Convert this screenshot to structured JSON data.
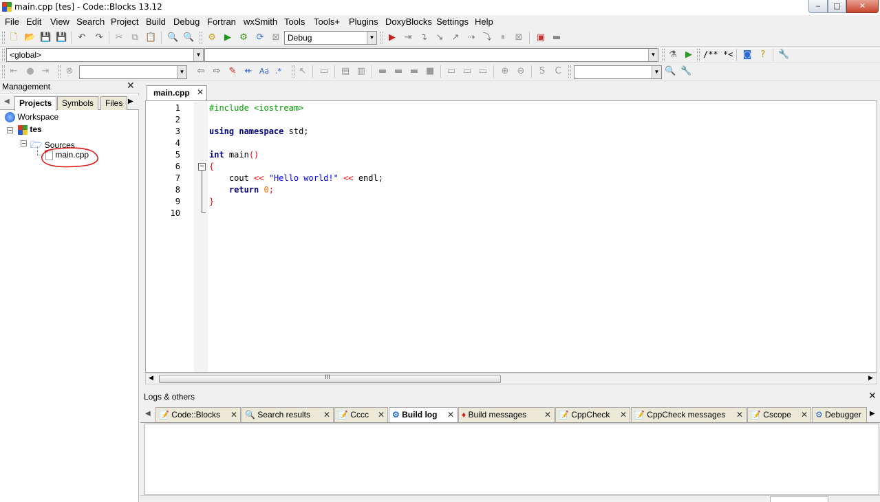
{
  "window": {
    "title": "main.cpp [tes] - Code::Blocks 13.12",
    "min": "‒",
    "max": "□",
    "close": "✕"
  },
  "menu": [
    "File",
    "Edit",
    "View",
    "Search",
    "Project",
    "Build",
    "Debug",
    "Fortran",
    "wxSmith",
    "Tools",
    "Tools+",
    "Plugins",
    "DoxyBlocks",
    "Settings",
    "Help"
  ],
  "toolbar1": {
    "build_target": "Debug"
  },
  "toolbar2": {
    "scope": "<global>",
    "function": "",
    "doxy_comment": "/** *<"
  },
  "toolbar3": {
    "search_text": "",
    "regex_label": ".*"
  },
  "management": {
    "title": "Management",
    "tabs": [
      "Projects",
      "Symbols",
      "Files"
    ],
    "tree": {
      "workspace": "Workspace",
      "project": "tes",
      "folder": "Sources",
      "file": "main.cpp"
    }
  },
  "editor": {
    "tab": "main.cpp",
    "line_numbers": [
      "1",
      "2",
      "3",
      "4",
      "5",
      "6",
      "7",
      "8",
      "9",
      "10"
    ],
    "lines": {
      "l1": "#include <iostream>",
      "l3a": "using",
      "l3b": "namespace",
      "l3c": "std;",
      "l5a": "int",
      "l5b": "main",
      "l5c": "()",
      "l6": "{",
      "l7a": "cout",
      "l7b": "<<",
      "l7c": "\"Hello world!\"",
      "l7d": "<<",
      "l7e": "endl;",
      "l8a": "return",
      "l8b": "0",
      "l8c": ";",
      "l9": "}"
    },
    "hscroll_label": "III"
  },
  "logs": {
    "title": "Logs & others",
    "tabs": [
      "Code::Blocks",
      "Search results",
      "Cccc",
      "Build log",
      "Build messages",
      "CppCheck",
      "CppCheck messages",
      "Cscope",
      "Debugger"
    ],
    "active_tab": "Build log"
  },
  "colors": {
    "annotation_circle": "#e01010",
    "preprocessor": "#00a000",
    "keyword": "#00007f",
    "string": "#0000ff",
    "number": "#f07000",
    "operator": "#ff0000"
  }
}
